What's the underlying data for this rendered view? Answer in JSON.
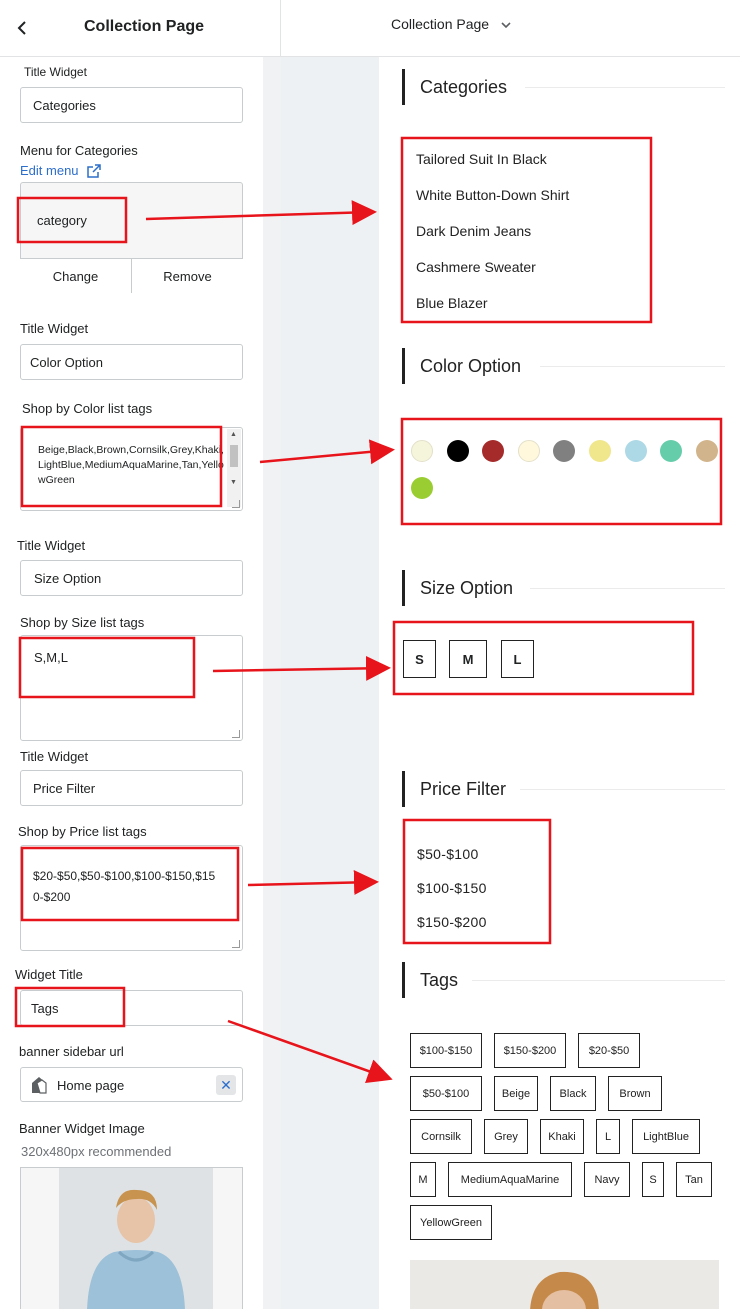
{
  "header": {
    "panel_title": "Collection Page",
    "page_selector": "Collection Page"
  },
  "panel": {
    "categories": {
      "title_label": "Title Widget",
      "title_value": "Categories",
      "menu_label": "Menu for Categories",
      "edit_menu": "Edit menu",
      "menu_name": "category",
      "change": "Change",
      "remove": "Remove"
    },
    "color": {
      "title_label": "Title Widget",
      "title_value": "Color Option",
      "tags_label": "Shop by Color list tags",
      "tags_value": "Beige,Black,Brown,Cornsilk,Grey,Khaki,LightBlue,MediumAquaMarine,Tan,YellowGreen"
    },
    "size": {
      "title_label": "Title Widget",
      "title_value": "Size Option",
      "tags_label": "Shop by Size list tags",
      "tags_value": "S,M,L"
    },
    "price": {
      "title_label": "Title Widget",
      "title_value": "Price Filter",
      "tags_label": "Shop by Price list tags",
      "tags_value": "$20-$50,$50-$100,$100-$150,$150-$200"
    },
    "tags": {
      "title_label": "Widget Title",
      "title_value": "Tags"
    },
    "banner": {
      "url_label": "banner sidebar url",
      "url_value": "Home page",
      "image_label": "Banner Widget Image",
      "image_hint": "320x480px recommended"
    }
  },
  "preview": {
    "categories_title": "Categories",
    "categories": [
      "Tailored Suit In Black",
      "White Button-Down Shirt",
      "Dark Denim Jeans",
      "Cashmere Sweater",
      "Blue Blazer"
    ],
    "color_title": "Color Option",
    "colors": [
      "#f5f5dc",
      "#000000",
      "#a52a2a",
      "#fff8dc",
      "#808080",
      "#f0e68c",
      "#add8e6",
      "#66cdaa",
      "#d2b48c",
      "#9acd32"
    ],
    "size_title": "Size Option",
    "sizes": [
      "S",
      "M",
      "L"
    ],
    "price_title": "Price Filter",
    "prices": [
      "$50-$100",
      "$100-$150",
      "$150-$200"
    ],
    "tags_title": "Tags",
    "tags": [
      "$100-$150",
      "$150-$200",
      "$20-$50",
      "$50-$100",
      "Beige",
      "Black",
      "Brown",
      "Cornsilk",
      "Grey",
      "Khaki",
      "L",
      "LightBlue",
      "M",
      "MediumAquaMarine",
      "Navy",
      "S",
      "Tan",
      "YellowGreen"
    ]
  },
  "annotation_color": "#e8141b"
}
